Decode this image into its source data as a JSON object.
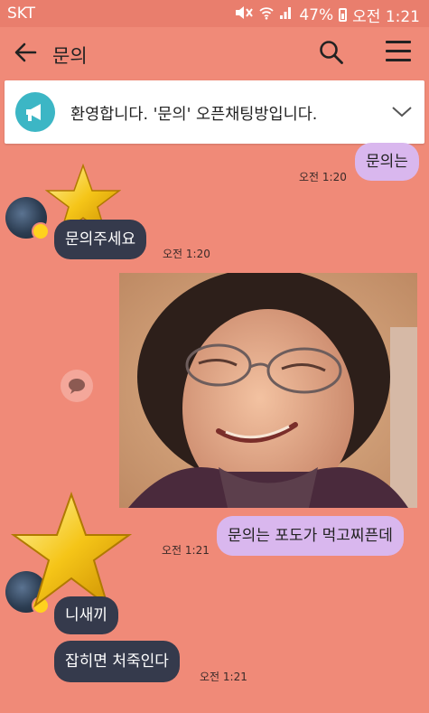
{
  "status": {
    "carrier": "SKT",
    "battery": "47%",
    "time": "오전 1:21"
  },
  "header": {
    "title": "문의"
  },
  "notice": {
    "text": "환영합니다. '문의' 오픈채팅방입니다."
  },
  "messages": [
    {
      "side": "out",
      "text": "문의는",
      "time": "오전 1:20"
    },
    {
      "side": "in",
      "text": "문의주세요",
      "time": "오전 1:20"
    },
    {
      "side": "out",
      "text": "문의는 포도가 먹고찌픈데",
      "time": "오전 1:21"
    },
    {
      "side": "in",
      "text": "니새끼",
      "time": ""
    },
    {
      "side": "in",
      "text": "잡히면 처죽인다",
      "time": "오전 1:21"
    }
  ],
  "colors": {
    "background": "#f08a78",
    "incoming_bubble": "#353a4c",
    "outgoing_bubble": "#d9b7ee",
    "notice_icon": "#3cb6c5"
  }
}
